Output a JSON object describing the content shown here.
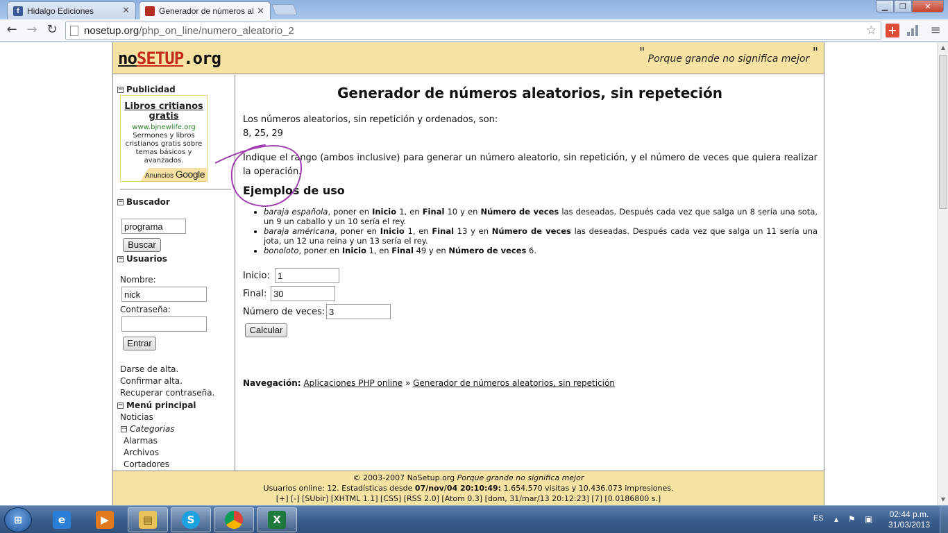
{
  "browser": {
    "tabs": [
      {
        "title": "Hidalgo Ediciones",
        "favicon": "facebook-icon",
        "active": false
      },
      {
        "title": "Generador de números ale",
        "favicon": "nosetup-icon",
        "active": true
      }
    ],
    "url_host": "nosetup.org",
    "url_path": "/php_on_line/numero_aleatorio_2"
  },
  "site": {
    "logo_no": "no",
    "logo_setup": "SETUP",
    "logo_org": ".org",
    "slogan": "Porque grande no significa mejor",
    "slogan_open_quote": "\"",
    "slogan_close_quote": "\""
  },
  "sidebar": {
    "ads_title": "Publicidad",
    "ad": {
      "title": "Libros critianos gratis",
      "url": "www.bjnewlife.org",
      "text": "Sermones y libros cristianos gratis sobre temas básicos y avanzados.",
      "footer_prefix": "Anuncios",
      "footer_brand": "Google"
    },
    "search_title": "Buscador",
    "search_value": "programa",
    "search_button": "Buscar",
    "users_title": "Usuarios",
    "name_label": "Nombre:",
    "name_value": "nick",
    "password_label": "Contraseña:",
    "password_value": "",
    "login_button": "Entrar",
    "links": [
      "Darse de alta.",
      "Confirmar alta.",
      "Recuperar contraseña."
    ],
    "menu_title": "Menú principal",
    "menu_news": "Noticias",
    "categories_title": "Categorias",
    "categories": [
      "Alarmas",
      "Archivos",
      "Cortadores"
    ]
  },
  "main": {
    "title": "Generador de números aleatorios, sin repeteción",
    "result_intro": "Los números aleatorios, sin repetición y ordenados, son:",
    "result_values": "8, 25, 29",
    "instructions": "Indique el rango (ambos inclusive) para generar un número aleatorio, sin repetición, y el número de veces que quiera realizar la operación.",
    "examples_title": "Ejemplos de uso",
    "examples": [
      {
        "term": "baraja española",
        "a": ", poner en ",
        "b1": "Inicio",
        "c": " 1, en ",
        "b2": "Final",
        "d": " 10 y en ",
        "b3": "Número de veces",
        "e": " las deseadas. Después cada vez que salga un 8 sería una sota, un 9 un caballo y un 10 sería el rey."
      },
      {
        "term": "baraja américana",
        "a": ", poner en ",
        "b1": "Inicio",
        "c": " 1, en ",
        "b2": "Final",
        "d": " 13 y en ",
        "b3": "Número de veces",
        "e": " las deseadas. Después cada vez que salga un 11 sería una jota, un 12 una reina y un 13 sería el rey."
      },
      {
        "term": "bonoloto",
        "a": ", poner en ",
        "b1": "Inicio",
        "c": " 1, en ",
        "b2": "Final",
        "d": " 49 y en ",
        "b3": "Número de veces",
        "e": " 6."
      }
    ],
    "start_label": "Inicio:",
    "start_value": "1",
    "end_label": "Final:",
    "end_value": "30",
    "times_label": "Número de veces:",
    "times_value": "3",
    "calc_button": "Calcular",
    "nav_label": "Navegación:",
    "nav_link1": "Aplicaciones PHP online",
    "nav_sep": "»",
    "nav_link2": "Generador de números aleatorios, sin repetición",
    "annotation_color": "#a040b0"
  },
  "footer": {
    "copyright": "© 2003-2007 NoSetup.org",
    "copyright_slogan": "Porque grande no significa mejor",
    "stats_prefix": "Usuarios online: 12. Estadísticas desde",
    "stats_date": "07/nov/04 20:10:49:",
    "stats_suffix": "1.654.570 visitas y 10.436.073 impresiones.",
    "line3": "[+] [-] [SUbir] [XHTML 1.1] [CSS] [RSS 2.0] [Atom 0.3] [dom, 31/mar/13 20:12:23] [7] [0.0186800 s.]"
  },
  "taskbar": {
    "apps": [
      "internet-explorer-icon",
      "media-player-icon",
      "explorer-folder-icon",
      "skype-icon",
      "chrome-icon",
      "excel-icon"
    ],
    "language": "ES",
    "time": "02:44 p.m.",
    "date": "31/03/2013"
  }
}
